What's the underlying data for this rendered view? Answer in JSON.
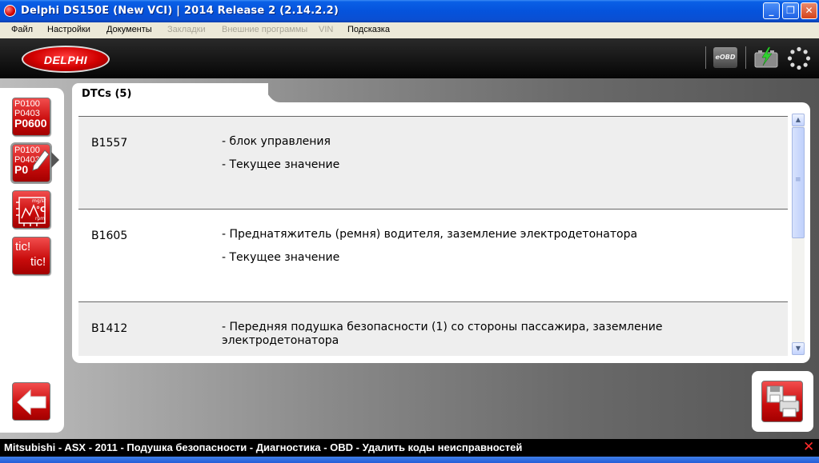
{
  "window": {
    "title": "Delphi DS150E (New VCI)  |  2014 Release 2 (2.14.2.2)",
    "minimize_glyph": "_",
    "maximize_glyph": "❐",
    "close_glyph": "✕"
  },
  "menu": {
    "items": [
      {
        "label": "Файл",
        "enabled": true
      },
      {
        "label": "Настройки",
        "enabled": true
      },
      {
        "label": "Документы",
        "enabled": true
      },
      {
        "label": "Закладки",
        "enabled": false
      },
      {
        "label": "Внешние программы",
        "enabled": false
      },
      {
        "label": "VIN",
        "enabled": false
      },
      {
        "label": "Подсказка",
        "enabled": true
      }
    ]
  },
  "header": {
    "logo_text": "DELPHI",
    "eobd_label": "eOBD",
    "icons": [
      "eobd-icon",
      "battery-icon",
      "spinner-icon"
    ]
  },
  "sidebar": {
    "dtc_codes_lines": [
      "P0100",
      "P0403",
      "P0600"
    ],
    "clear_codes_lines": [
      "P0100",
      "P0403",
      "P0"
    ],
    "live_data_lines": [
      "mg/sr",
      "°C",
      "rpm"
    ],
    "tic_lines": [
      "tic!",
      "tic!"
    ],
    "active_index": 1
  },
  "dtc_panel": {
    "tab_label": "DTCs (5)",
    "rows": [
      {
        "code": "B1557",
        "description": "- блок управления",
        "value": "- Текущее значение"
      },
      {
        "code": "B1605",
        "description": "- Преднатяжитель (ремня) водителя, заземление электродетонатора",
        "value": "- Текущее значение"
      },
      {
        "code": "B1412",
        "description": "- Передняя подушка безопасности (1) со стороны пассажира, заземление электродетонатора",
        "value": ""
      }
    ],
    "scroll_up_glyph": "▲",
    "scroll_down_glyph": "▼",
    "scroll_grip_glyph": "≡"
  },
  "statusbar": {
    "text": "Mitsubishi - ASX - 2011 - Подушка безопасности - Диагностика - OBD - Удалить коды неисправностей",
    "close_glyph": "✕"
  },
  "colors": {
    "accent_red": "#d10000",
    "titlebar_blue": "#0553dc"
  }
}
